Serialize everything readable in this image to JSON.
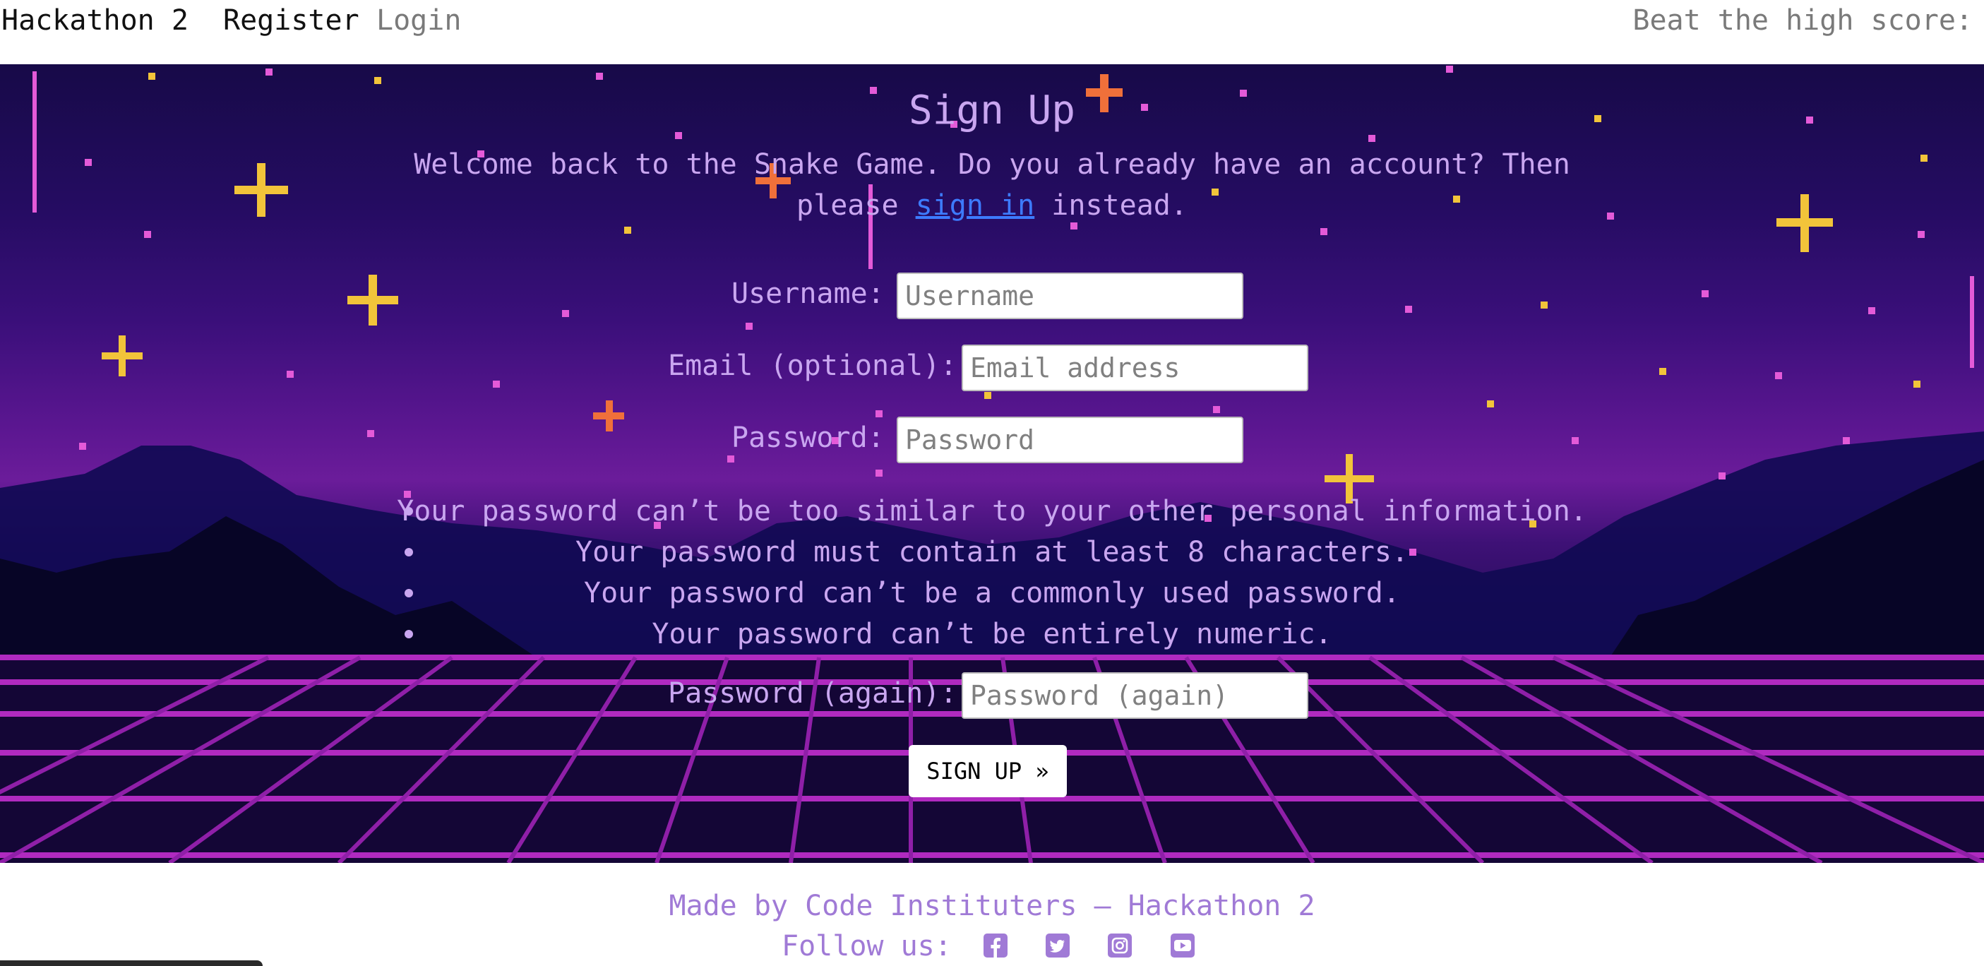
{
  "nav": {
    "brand": "Hackathon 2",
    "register": "Register",
    "login": "Login",
    "highscore": "Beat the high score:"
  },
  "signup": {
    "title": "Sign Up",
    "intro_before": "Welcome back to the Snake Game. Do you already have an account? Then please ",
    "intro_link": "sign in",
    "intro_after": " instead.",
    "username_label": "Username:",
    "username_placeholder": "Username",
    "email_label": "Email (optional):",
    "email_placeholder": "Email address",
    "password_label": "Password:",
    "password_placeholder": "Password",
    "password_rules": [
      "Your password can’t be too similar to your other personal information.",
      "Your password must contain at least 8 characters.",
      "Your password can’t be a commonly used password.",
      "Your password can’t be entirely numeric."
    ],
    "password2_label": "Password (again):",
    "password2_placeholder": "Password (again)",
    "submit": "SIGN UP »"
  },
  "footer": {
    "made_by": "Made by Code Instituters — Hackathon 2",
    "follow": "Follow us:",
    "social_icons": [
      "facebook-icon",
      "twitter-icon",
      "instagram-icon",
      "youtube-icon"
    ]
  },
  "colors": {
    "text_lavender": "#c9a6f0",
    "link_blue": "#3d7bff",
    "footer_purple": "#a07ad6",
    "star_yellow": "#f2c43a",
    "star_orange": "#f0703a",
    "grid_magenta": "#b02ac0"
  }
}
